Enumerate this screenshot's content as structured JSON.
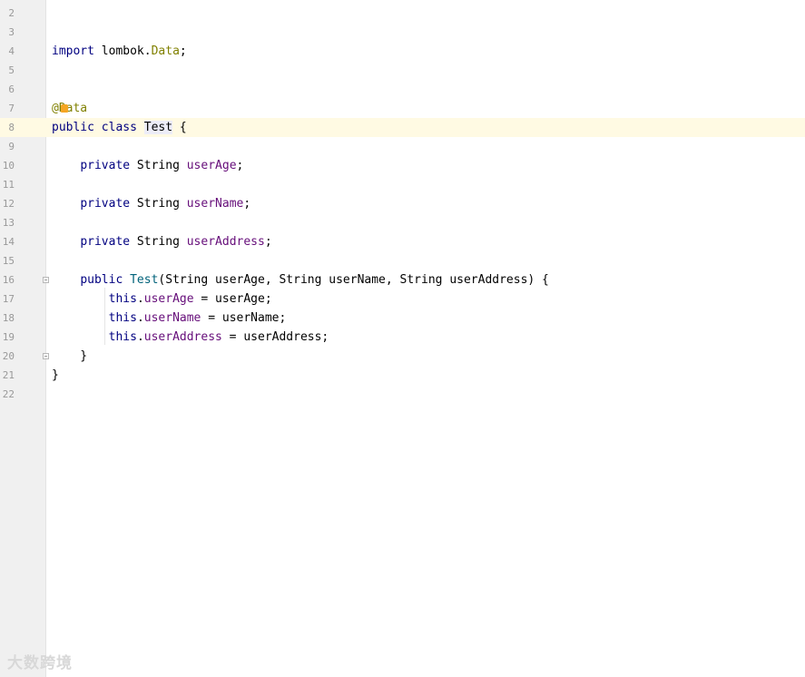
{
  "editor": {
    "lines": [
      {
        "number": "2"
      },
      {
        "number": "3"
      },
      {
        "number": "4",
        "tokens": [
          {
            "t": "import",
            "c": "kw"
          },
          {
            "t": " lombok."
          },
          {
            "t": "Data",
            "c": "ann"
          },
          {
            "t": ";"
          }
        ]
      },
      {
        "number": "5"
      },
      {
        "number": "6"
      },
      {
        "number": "7",
        "tokens": [
          {
            "t": "@Data",
            "c": "ann"
          }
        ],
        "bulb": true
      },
      {
        "number": "8",
        "current": true,
        "tokens": [
          {
            "t": "public",
            "c": "kw"
          },
          {
            "t": " "
          },
          {
            "t": "class",
            "c": "kw"
          },
          {
            "t": " "
          },
          {
            "t": "Test",
            "c": "cls-hl"
          },
          {
            "t": " {"
          }
        ]
      },
      {
        "number": "9"
      },
      {
        "number": "10",
        "tokens": [
          {
            "t": "    "
          },
          {
            "t": "private",
            "c": "kw"
          },
          {
            "t": " String "
          },
          {
            "t": "userAge",
            "c": "field"
          },
          {
            "t": ";"
          }
        ]
      },
      {
        "number": "11"
      },
      {
        "number": "12",
        "tokens": [
          {
            "t": "    "
          },
          {
            "t": "private",
            "c": "kw"
          },
          {
            "t": " String "
          },
          {
            "t": "userName",
            "c": "field"
          },
          {
            "t": ";"
          }
        ]
      },
      {
        "number": "13"
      },
      {
        "number": "14",
        "tokens": [
          {
            "t": "    "
          },
          {
            "t": "private",
            "c": "kw"
          },
          {
            "t": " String "
          },
          {
            "t": "userAddress",
            "c": "field"
          },
          {
            "t": ";"
          }
        ]
      },
      {
        "number": "15"
      },
      {
        "number": "16",
        "fold": true,
        "tokens": [
          {
            "t": "    "
          },
          {
            "t": "public",
            "c": "kw"
          },
          {
            "t": " "
          },
          {
            "t": "Test",
            "c": "meth"
          },
          {
            "t": "(String userAge, String userName, String userAddress) {"
          }
        ]
      },
      {
        "number": "17",
        "tokens": [
          {
            "t": "        "
          },
          {
            "t": "this",
            "c": "kw"
          },
          {
            "t": "."
          },
          {
            "t": "userAge",
            "c": "field"
          },
          {
            "t": " = userAge;"
          }
        ]
      },
      {
        "number": "18",
        "tokens": [
          {
            "t": "        "
          },
          {
            "t": "this",
            "c": "kw"
          },
          {
            "t": "."
          },
          {
            "t": "userName",
            "c": "field"
          },
          {
            "t": " = userName;"
          }
        ]
      },
      {
        "number": "19",
        "tokens": [
          {
            "t": "        "
          },
          {
            "t": "this",
            "c": "kw"
          },
          {
            "t": "."
          },
          {
            "t": "userAddress",
            "c": "field"
          },
          {
            "t": " = userAddress;"
          }
        ]
      },
      {
        "number": "20",
        "fold": true,
        "tokens": [
          {
            "t": "    }"
          }
        ]
      },
      {
        "number": "21",
        "tokens": [
          {
            "t": "}"
          }
        ]
      },
      {
        "number": "22"
      }
    ]
  },
  "watermark": {
    "text": "大数跨境"
  },
  "colors": {
    "keyword": "#000080",
    "annotation": "#808000",
    "field": "#660e7a",
    "method": "#00627a",
    "current_line": "#fffae3",
    "gutter": "#f0f0f0",
    "bulb": "#f5a623"
  },
  "icons": {
    "intention": "lightbulb-icon",
    "fold": "fold-marker-icon"
  }
}
